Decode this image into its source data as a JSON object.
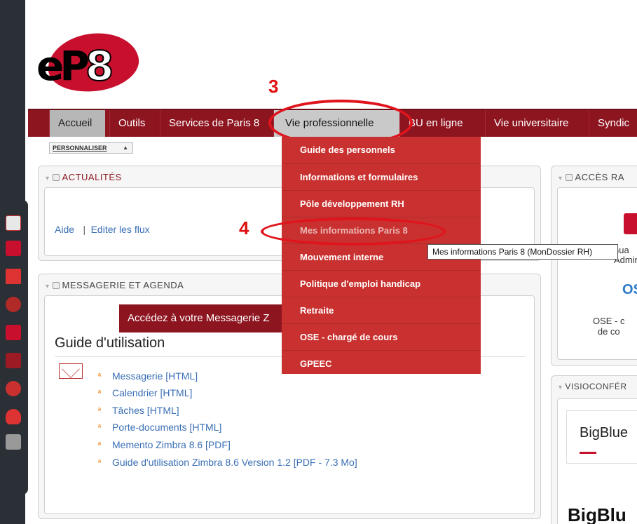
{
  "logo": {
    "text_e": "e",
    "text_p": "P",
    "text_8": "8"
  },
  "nav": {
    "items": [
      {
        "label": "Accueil"
      },
      {
        "label": "Outils"
      },
      {
        "label": "Services de Paris 8"
      },
      {
        "label": "Vie professionnelle"
      },
      {
        "label": "BU en ligne"
      },
      {
        "label": "Vie universitaire"
      },
      {
        "label": "Syndic"
      }
    ]
  },
  "personnaliser": "PERSONNALISER",
  "actualites": {
    "title": "ACTUALITÉS",
    "aide": "Aide",
    "sep": "|",
    "editer": "Editer les flux"
  },
  "messagerie": {
    "title": "MESSAGERIE ET AGENDA",
    "banner": "Accédez à votre Messagerie Z",
    "guide_title": "Guide d'utilisation",
    "links": [
      "Messagerie [HTML]",
      "Calendrier [HTML]",
      "Tâches [HTML]",
      "Porte-documents [HTML]",
      "Memento Zimbra 8.6 [PDF]",
      "Guide d'utilisation Zimbra 8.6 Version 1.2 [PDF - 7.3 Mo]"
    ]
  },
  "acces": {
    "title": "ACCÈS RA",
    "text_line1": "nua",
    "text_line2": "Adminis",
    "ose_logo": "OS",
    "ose_line1": "OSE - c",
    "ose_line2": "de co"
  },
  "visio": {
    "title": "VISIOCONFÉR",
    "bbb": "BigBlue",
    "bbb_big": "BigBlu"
  },
  "dropdown": {
    "items": [
      "Guide des personnels",
      "Informations et formulaires",
      "Pôle développement RH",
      "Mes informations Paris 8",
      "Mouvement interne",
      "Politique d'emploi handicap",
      "Retraite",
      "OSE - chargé de cours",
      "GPEEC"
    ]
  },
  "tooltip": "Mes informations Paris 8 (MonDossier RH)",
  "annotations": {
    "step3": "3",
    "step4": "4"
  },
  "colors": {
    "brand_red": "#8d1520",
    "dropdown_red": "#c8312f",
    "annotation_red": "#e0141c"
  }
}
